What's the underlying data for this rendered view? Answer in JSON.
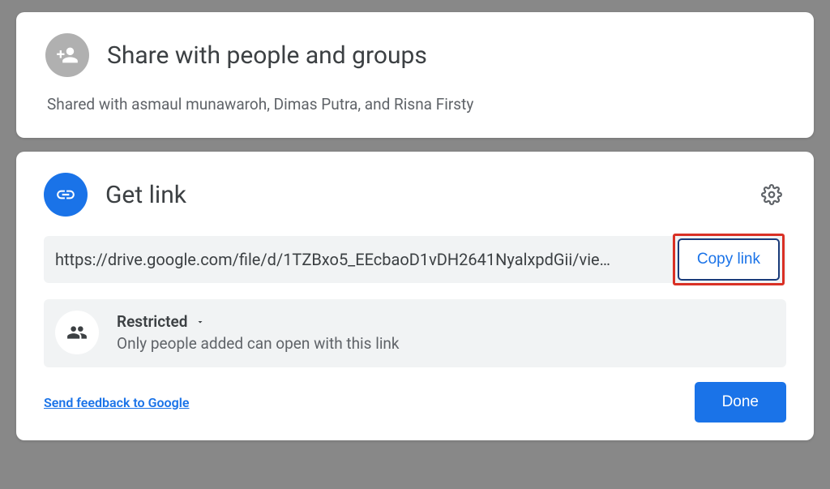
{
  "share": {
    "title": "Share with people and groups",
    "subtitle": "Shared with asmaul munawaroh, Dimas Putra, and Risna Firsty"
  },
  "link": {
    "title": "Get link",
    "url": "https://drive.google.com/file/d/1TZBxo5_EEcbaoD1vDH2641NyalxpdGii/vie…",
    "copy_label": "Copy link",
    "access": {
      "label": "Restricted",
      "description": "Only people added can open with this link"
    },
    "feedback": "Send feedback to Google",
    "done": "Done"
  }
}
